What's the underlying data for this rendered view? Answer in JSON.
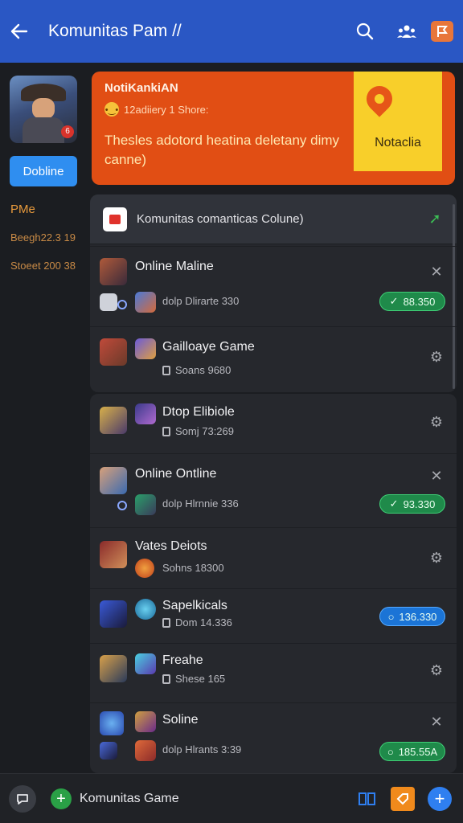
{
  "header": {
    "title": "Komunitas Pam //",
    "icons": [
      "back-arrow-icon",
      "search-icon",
      "people-icon",
      "flag-icon"
    ]
  },
  "sidebar": {
    "button_label": "Dobline",
    "heading": "PMe",
    "stats": [
      "Beegh22.3 19",
      "Stoeet 200 38"
    ]
  },
  "promo": {
    "title": "NotiKankiAN",
    "subtitle": "12adiiery 1 Shore:",
    "body": "Thesles adotord heatina deletany dimy canne)",
    "card_label": "Notaclia",
    "colors": {
      "banner": "#e14e14",
      "card": "#f8cf2a"
    }
  },
  "panel": {
    "header_label": "Komunitas comanticas Colune)"
  },
  "rows": [
    {
      "name": "Online Maline",
      "sub": "dolp Dlirarte 330",
      "action": "close",
      "pill": "88.350",
      "pill_color": "green"
    },
    {
      "name": "Gailloaye Game",
      "sub": "Soans 9680",
      "action": "gear",
      "pill": "",
      "pill_color": ""
    },
    {
      "name": "Dtop Elibiole",
      "sub": "Somj 73:269",
      "action": "gear",
      "pill": "",
      "pill_color": ""
    },
    {
      "name": "Online Ontline",
      "sub": "dolp Hlrnnie 336",
      "action": "close",
      "pill": "93.330",
      "pill_color": "green"
    },
    {
      "name": "Vates Deiots",
      "sub": "Sohns 18300",
      "action": "gear",
      "pill": "",
      "pill_color": ""
    },
    {
      "name": "Sapelkicals",
      "sub": "Dom 14.336",
      "action": "none",
      "pill": "136.330",
      "pill_color": "blue"
    },
    {
      "name": "Freahe",
      "sub": "Shese 165",
      "action": "gear",
      "pill": "",
      "pill_color": ""
    },
    {
      "name": "Soline",
      "sub": "dolp Hlrants 3:39",
      "action": "close",
      "pill": "185.55A",
      "pill_color": "green"
    }
  ],
  "bottom_bar": {
    "label": "Komunitas Game",
    "icons": [
      "chat-icon",
      "add-icon",
      "cards-icon",
      "tag-icon",
      "fab-add-icon"
    ]
  }
}
